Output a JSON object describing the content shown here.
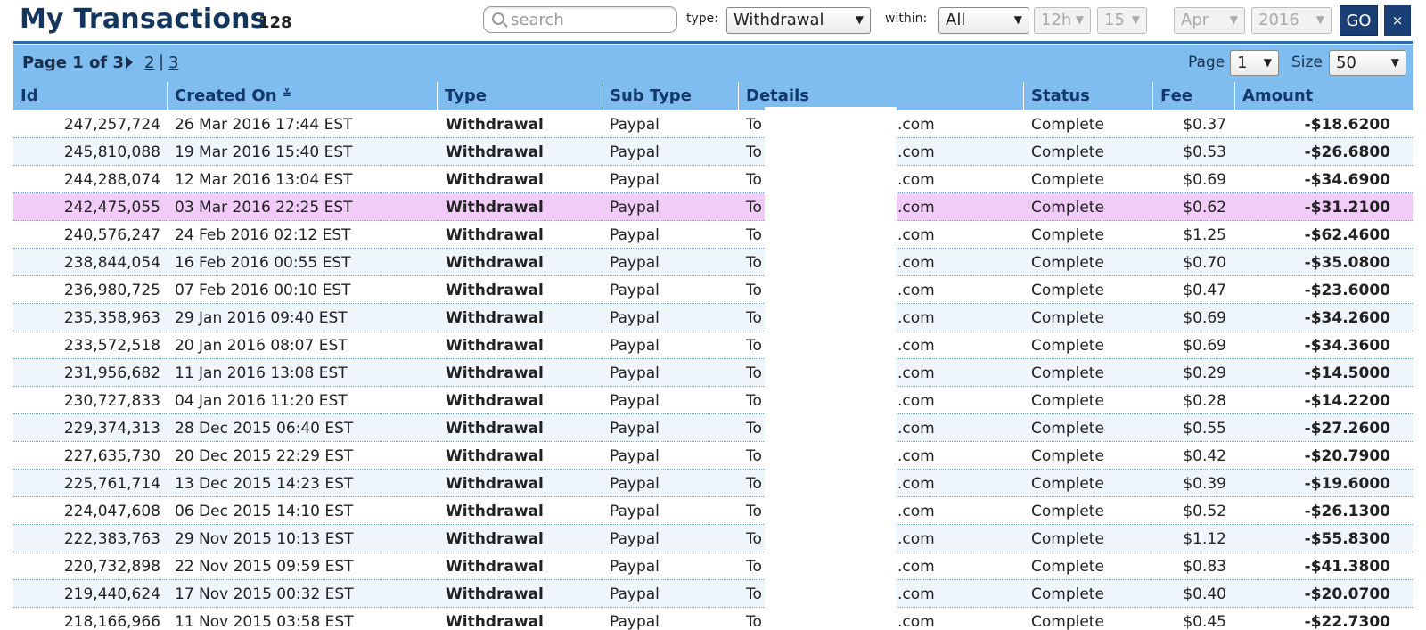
{
  "header": {
    "title": "My Transactions",
    "count": "128",
    "search_placeholder": "search",
    "type_label": "type:",
    "type_value": "Withdrawal",
    "within_label": "within:",
    "within_value": "All",
    "hour_value": "12h",
    "day_value": "15",
    "month_value": "Apr",
    "year_value": "2016",
    "go_label": "GO",
    "close_label": "×"
  },
  "pagination": {
    "info": "Page 1 of 3",
    "links": [
      "2",
      "3"
    ],
    "separator": "|",
    "page_label": "Page",
    "page_value": "1",
    "size_label": "Size",
    "size_value": "50"
  },
  "table": {
    "columns": [
      "Id",
      "Created On",
      "Type",
      "Sub Type",
      "Details",
      "Status",
      "Fee",
      "Amount"
    ],
    "details_prefix": "To",
    "details_suffix": ".com",
    "rows": [
      {
        "id": "247,257,724",
        "date": "26 Mar 2016 17:44 EST",
        "type": "Withdrawal",
        "sub": "Paypal",
        "status": "Complete",
        "fee": "$0.37",
        "amount": "-$18.6200"
      },
      {
        "id": "245,810,088",
        "date": "19 Mar 2016 15:40 EST",
        "type": "Withdrawal",
        "sub": "Paypal",
        "status": "Complete",
        "fee": "$0.53",
        "amount": "-$26.6800"
      },
      {
        "id": "244,288,074",
        "date": "12 Mar 2016 13:04 EST",
        "type": "Withdrawal",
        "sub": "Paypal",
        "status": "Complete",
        "fee": "$0.69",
        "amount": "-$34.6900"
      },
      {
        "id": "242,475,055",
        "date": "03 Mar 2016 22:25 EST",
        "type": "Withdrawal",
        "sub": "Paypal",
        "status": "Complete",
        "fee": "$0.62",
        "amount": "-$31.2100"
      },
      {
        "id": "240,576,247",
        "date": "24 Feb 2016 02:12 EST",
        "type": "Withdrawal",
        "sub": "Paypal",
        "status": "Complete",
        "fee": "$1.25",
        "amount": "-$62.4600"
      },
      {
        "id": "238,844,054",
        "date": "16 Feb 2016 00:55 EST",
        "type": "Withdrawal",
        "sub": "Paypal",
        "status": "Complete",
        "fee": "$0.70",
        "amount": "-$35.0800"
      },
      {
        "id": "236,980,725",
        "date": "07 Feb 2016 00:10 EST",
        "type": "Withdrawal",
        "sub": "Paypal",
        "status": "Complete",
        "fee": "$0.47",
        "amount": "-$23.6000"
      },
      {
        "id": "235,358,963",
        "date": "29 Jan 2016 09:40 EST",
        "type": "Withdrawal",
        "sub": "Paypal",
        "status": "Complete",
        "fee": "$0.69",
        "amount": "-$34.2600"
      },
      {
        "id": "233,572,518",
        "date": "20 Jan 2016 08:07 EST",
        "type": "Withdrawal",
        "sub": "Paypal",
        "status": "Complete",
        "fee": "$0.69",
        "amount": "-$34.3600"
      },
      {
        "id": "231,956,682",
        "date": "11 Jan 2016 13:08 EST",
        "type": "Withdrawal",
        "sub": "Paypal",
        "status": "Complete",
        "fee": "$0.29",
        "amount": "-$14.5000"
      },
      {
        "id": "230,727,833",
        "date": "04 Jan 2016 11:20 EST",
        "type": "Withdrawal",
        "sub": "Paypal",
        "status": "Complete",
        "fee": "$0.28",
        "amount": "-$14.2200"
      },
      {
        "id": "229,374,313",
        "date": "28 Dec 2015 06:40 EST",
        "type": "Withdrawal",
        "sub": "Paypal",
        "status": "Complete",
        "fee": "$0.55",
        "amount": "-$27.2600"
      },
      {
        "id": "227,635,730",
        "date": "20 Dec 2015 22:29 EST",
        "type": "Withdrawal",
        "sub": "Paypal",
        "status": "Complete",
        "fee": "$0.42",
        "amount": "-$20.7900"
      },
      {
        "id": "225,761,714",
        "date": "13 Dec 2015 14:23 EST",
        "type": "Withdrawal",
        "sub": "Paypal",
        "status": "Complete",
        "fee": "$0.39",
        "amount": "-$19.6000"
      },
      {
        "id": "224,047,608",
        "date": "06 Dec 2015 14:10 EST",
        "type": "Withdrawal",
        "sub": "Paypal",
        "status": "Complete",
        "fee": "$0.52",
        "amount": "-$26.1300"
      },
      {
        "id": "222,383,763",
        "date": "29 Nov 2015 10:13 EST",
        "type": "Withdrawal",
        "sub": "Paypal",
        "status": "Complete",
        "fee": "$1.12",
        "amount": "-$55.8300"
      },
      {
        "id": "220,732,898",
        "date": "22 Nov 2015 09:59 EST",
        "type": "Withdrawal",
        "sub": "Paypal",
        "status": "Complete",
        "fee": "$0.83",
        "amount": "-$41.3800"
      },
      {
        "id": "219,440,624",
        "date": "17 Nov 2015 00:32 EST",
        "type": "Withdrawal",
        "sub": "Paypal",
        "status": "Complete",
        "fee": "$0.40",
        "amount": "-$20.0700"
      },
      {
        "id": "218,166,966",
        "date": "11 Nov 2015 03:58 EST",
        "type": "Withdrawal",
        "sub": "Paypal",
        "status": "Complete",
        "fee": "$0.45",
        "amount": "-$22.7300"
      }
    ],
    "highlighted_row": 3
  },
  "colors": {
    "title": "#14365e",
    "bar": "#7fbcf0",
    "button": "#1a3f75",
    "highlight": "#f1ccf7",
    "alt_row": "#eef6fc"
  }
}
